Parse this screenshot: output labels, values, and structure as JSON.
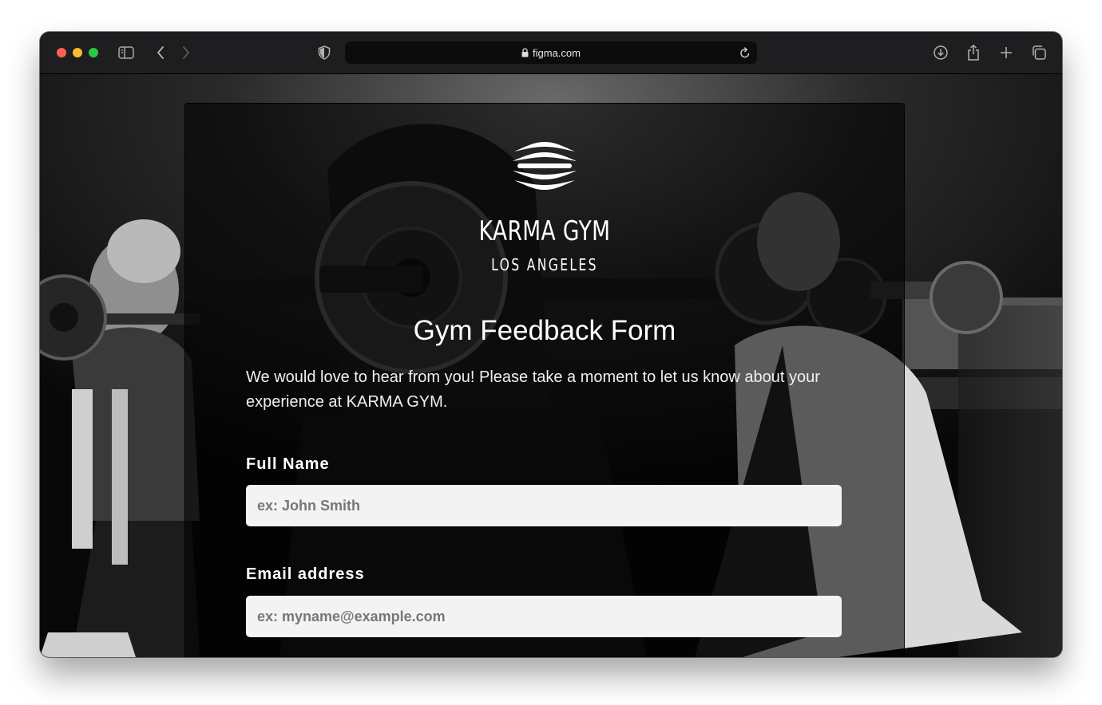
{
  "browser": {
    "url": "figma.com",
    "icons": [
      "close-light",
      "minimize-light",
      "zoom-light",
      "sidebar-icon",
      "back-icon",
      "forward-icon",
      "shield-icon",
      "lock-icon",
      "reload-icon",
      "download-icon",
      "share-icon",
      "new-tab-icon",
      "tabs-overview-icon"
    ],
    "colors": {
      "close": "#ff5f57",
      "minimize": "#febc2e",
      "zoom": "#28c840",
      "toolbar": "#1e1e20"
    }
  },
  "brand": {
    "name": "KARMA GYM",
    "location": "LOS ANGELES",
    "logo": "wave-lines-logo"
  },
  "form": {
    "title": "Gym Feedback Form",
    "intro": "We would love to hear from you! Please take a moment to let us know about your experience at KARMA GYM.",
    "fields": [
      {
        "label": "Full Name",
        "placeholder": "ex: John Smith",
        "value": ""
      },
      {
        "label": "Email address",
        "placeholder": "ex: myname@example.com",
        "value": ""
      }
    ]
  }
}
